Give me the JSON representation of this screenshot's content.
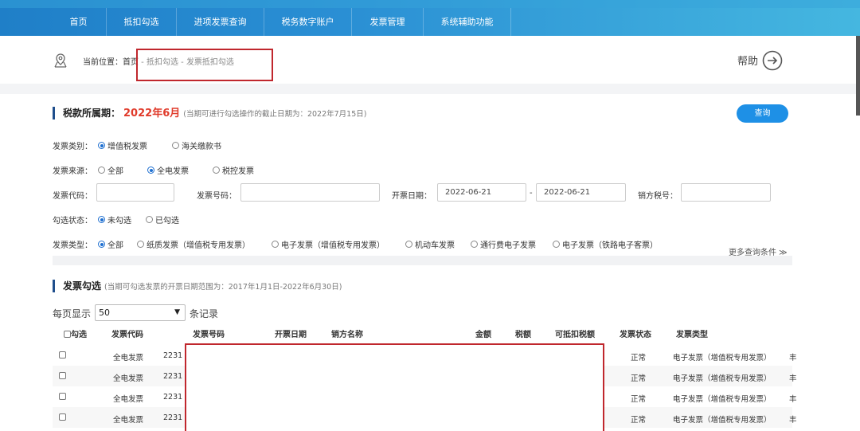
{
  "nav": [
    "首页",
    "抵扣勾选",
    "进项发票查询",
    "税务数字账户",
    "发票管理",
    "系统辅助功能"
  ],
  "breadcrumb": {
    "prefix": "当前位置：",
    "home": "首页",
    "sep": " - ",
    "level1": "抵扣勾选",
    "level2": "发票抵扣勾选"
  },
  "help_label": "帮助",
  "tax_period": {
    "label": "税款所属期：",
    "value": "2022年6月",
    "note": "(当期可进行勾选操作的截止日期为：2022年7月15日)"
  },
  "query_button": "查询",
  "filters": {
    "invoice_category": {
      "label": "发票类别：",
      "options": [
        {
          "text": "增值税发票",
          "on": true
        },
        {
          "text": "海关缴款书",
          "on": false
        }
      ]
    },
    "invoice_source": {
      "label": "发票来源：",
      "options": [
        {
          "text": "全部",
          "on": false
        },
        {
          "text": "全电发票",
          "on": true
        },
        {
          "text": "税控发票",
          "on": false
        }
      ]
    },
    "invoice_code_label": "发票代码：",
    "invoice_number_label": "发票号码：",
    "issue_date_label": "开票日期：",
    "date_from": "2022-06-21",
    "date_dash": "-",
    "date_to": "2022-06-21",
    "seller_tax_label": "销方税号：",
    "check_status": {
      "label": "勾选状态：",
      "options": [
        {
          "text": "未勾选",
          "on": true
        },
        {
          "text": "已勾选",
          "on": false
        }
      ]
    },
    "invoice_type": {
      "label": "发票类型：",
      "options": [
        {
          "text": "全部",
          "on": true
        },
        {
          "text": "纸质发票（增值税专用发票）",
          "on": false
        },
        {
          "text": "电子发票（增值税专用发票）",
          "on": false
        },
        {
          "text": "机动车发票",
          "on": false
        },
        {
          "text": "通行费电子发票",
          "on": false
        },
        {
          "text": "电子发票（铁路电子客票）",
          "on": false
        }
      ]
    },
    "more_conditions": "更多查询条件 ≫"
  },
  "selection": {
    "title": "发票勾选",
    "note": "(当期可勾选发票的开票日期范围为：2017年1月1日-2022年6月30日)",
    "per_page_label": "每页显示",
    "per_page_value": "50",
    "records_label": "条记录",
    "columns": [
      "勾选",
      "发票代码",
      "发票号码",
      "开票日期",
      "销方名称",
      "金额",
      "税额",
      "可抵扣税额",
      "发票状态",
      "发票类型"
    ],
    "rows": [
      {
        "source": "全电发票",
        "code": "2231",
        "status": "正常",
        "type": "电子发票（增值税专用发票）",
        "tail": "丰"
      },
      {
        "source": "全电发票",
        "code": "2231",
        "status": "正常",
        "type": "电子发票（增值税专用发票）",
        "tail": "丰"
      },
      {
        "source": "全电发票",
        "code": "2231",
        "status": "正常",
        "type": "电子发票（增值税专用发票）",
        "tail": "丰"
      },
      {
        "source": "全电发票",
        "code": "2231",
        "status": "正常",
        "type": "电子发票（增值税专用发票）",
        "tail": "丰"
      }
    ]
  },
  "colors": {
    "nav_start": "#1f7fc8",
    "nav_end": "#45b7e0",
    "accent": "#1e90e6",
    "period": "#e03b2b",
    "highlight_box": "#c0272d"
  }
}
